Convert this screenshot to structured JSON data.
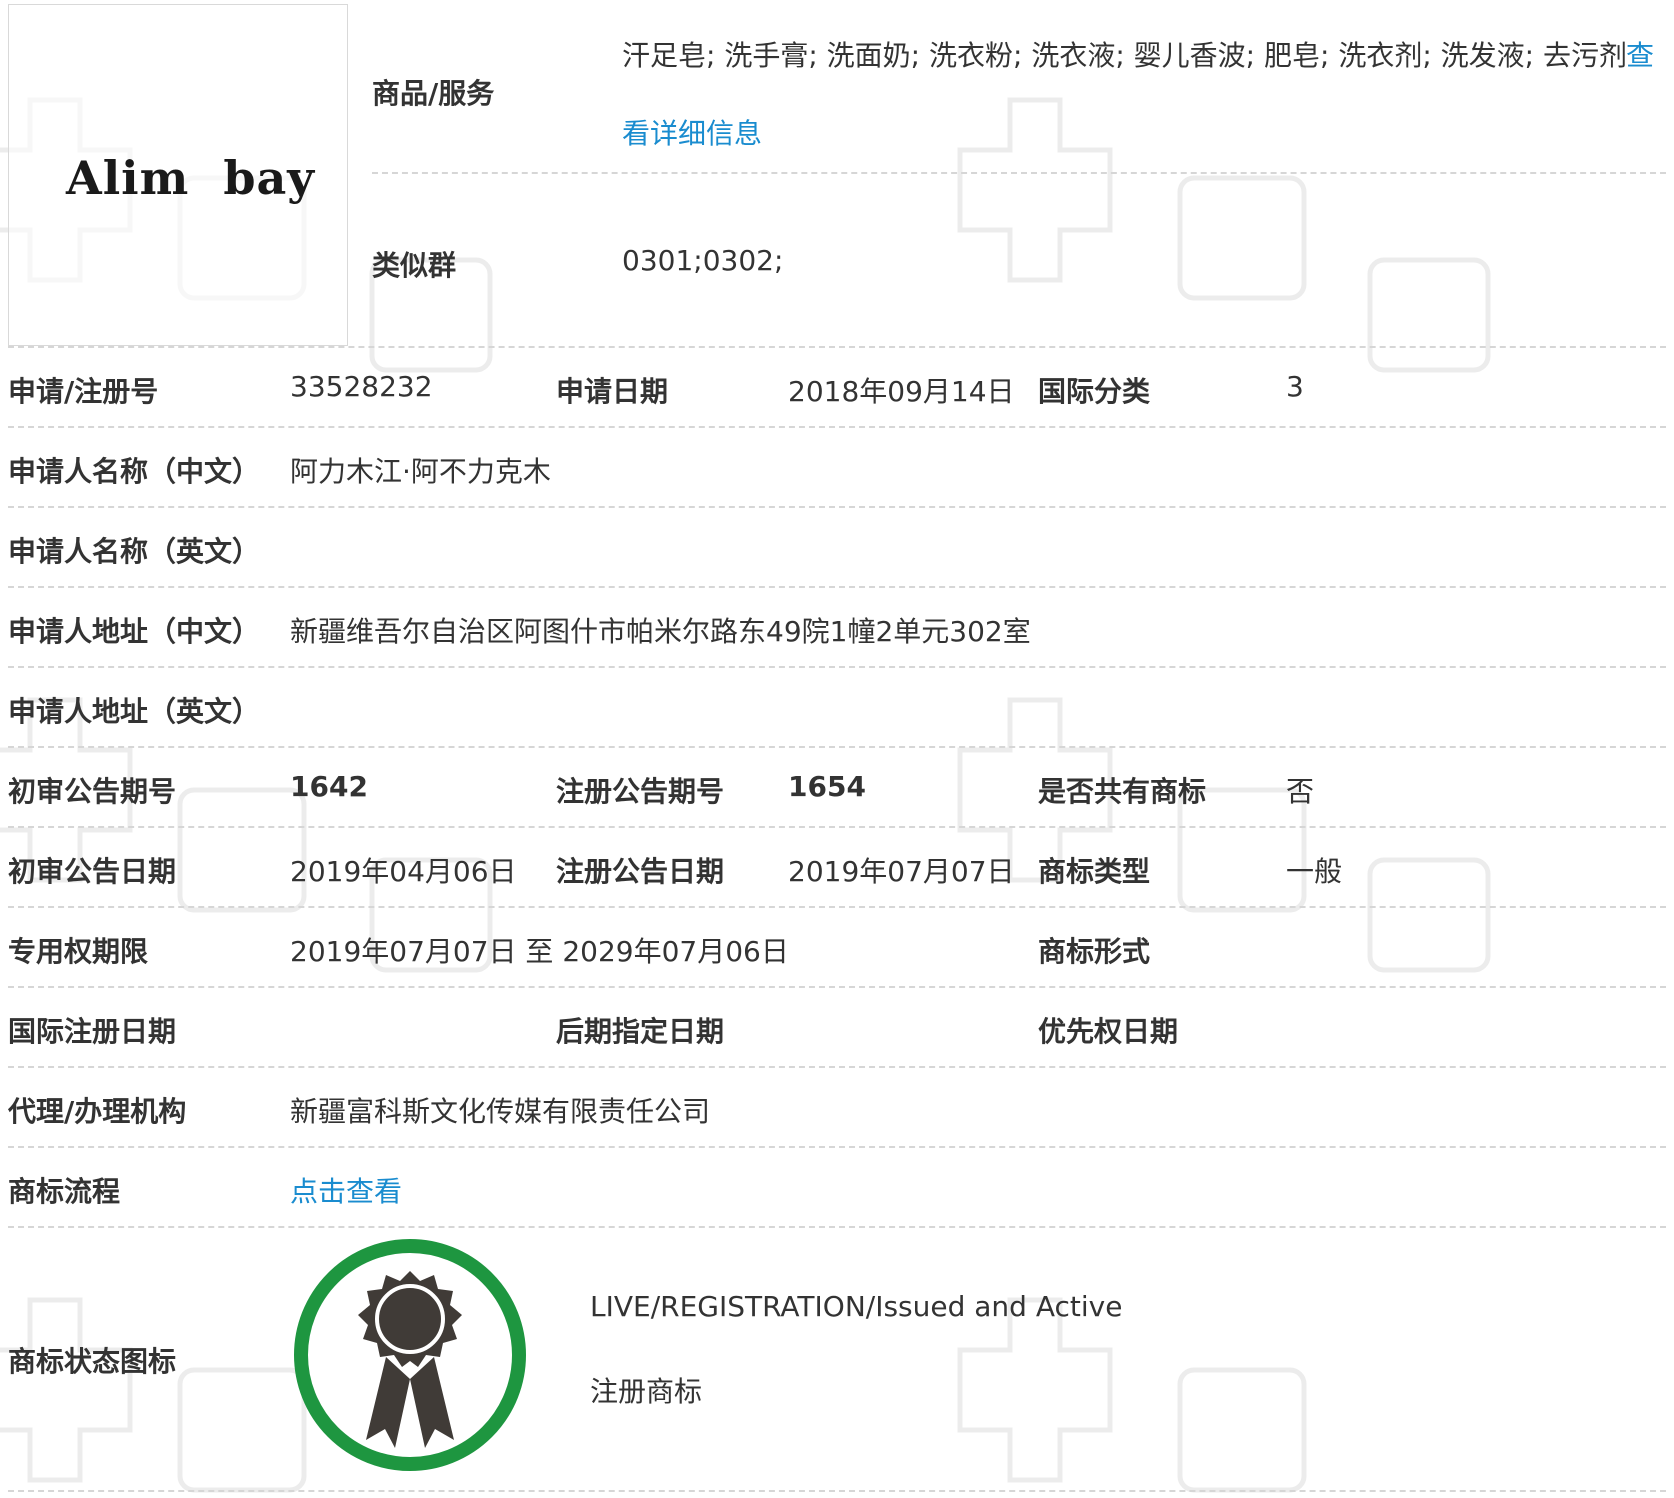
{
  "logo": {
    "text": "Alim  bay"
  },
  "goods": {
    "label": "商品/服务",
    "items": "汗足皂; 洗手膏; 洗面奶; 洗衣粉; 洗衣液; 婴儿香波; 肥皂; 洗衣剂; 洗发液; 去污剂",
    "more_link": "查",
    "detail_link": "看详细信息"
  },
  "similar_group": {
    "label": "类似群",
    "value": "0301;0302;"
  },
  "reg_no": {
    "label": "申请/注册号",
    "value": "33528232"
  },
  "apply_date": {
    "label": "申请日期",
    "value": "2018年09月14日"
  },
  "intl_class": {
    "label": "国际分类",
    "value": "3"
  },
  "applicant_cn": {
    "label": "申请人名称（中文）",
    "value": "阿力木江·阿不力克木"
  },
  "applicant_en": {
    "label": "申请人名称（英文）",
    "value": ""
  },
  "address_cn": {
    "label": "申请人地址（中文）",
    "value": "新疆维吾尔自治区阿图什市帕米尔路东49院1幢2单元302室"
  },
  "address_en": {
    "label": "申请人地址（英文）",
    "value": ""
  },
  "prelim_issue": {
    "label": "初审公告期号",
    "value": "1642"
  },
  "reg_issue": {
    "label": "注册公告期号",
    "value": "1654"
  },
  "shared_mark": {
    "label": "是否共有商标",
    "value": "否"
  },
  "prelim_date": {
    "label": "初审公告日期",
    "value": "2019年04月06日"
  },
  "reg_date": {
    "label": "注册公告日期",
    "value": "2019年07月07日"
  },
  "mark_type": {
    "label": "商标类型",
    "value": "一般"
  },
  "validity": {
    "label": "专用权期限",
    "value": "2019年07月07日 至 2029年07月06日"
  },
  "mark_form": {
    "label": "商标形式",
    "value": ""
  },
  "intl_reg_date": {
    "label": "国际注册日期",
    "value": ""
  },
  "later_date": {
    "label": "后期指定日期",
    "value": ""
  },
  "priority_date": {
    "label": "优先权日期",
    "value": ""
  },
  "agent": {
    "label": "代理/办理机构",
    "value": "新疆富科斯文化传媒有限责任公司"
  },
  "process": {
    "label": "商标流程",
    "link": "点击查看"
  },
  "status": {
    "label": "商标状态图标",
    "text_en": "LIVE/REGISTRATION/Issued and Active",
    "text_cn": "注册商标"
  },
  "colors": {
    "link": "#1a8ccf",
    "badge_ring": "#1e9640",
    "badge_medal": "#403b37",
    "label": "#333333"
  }
}
